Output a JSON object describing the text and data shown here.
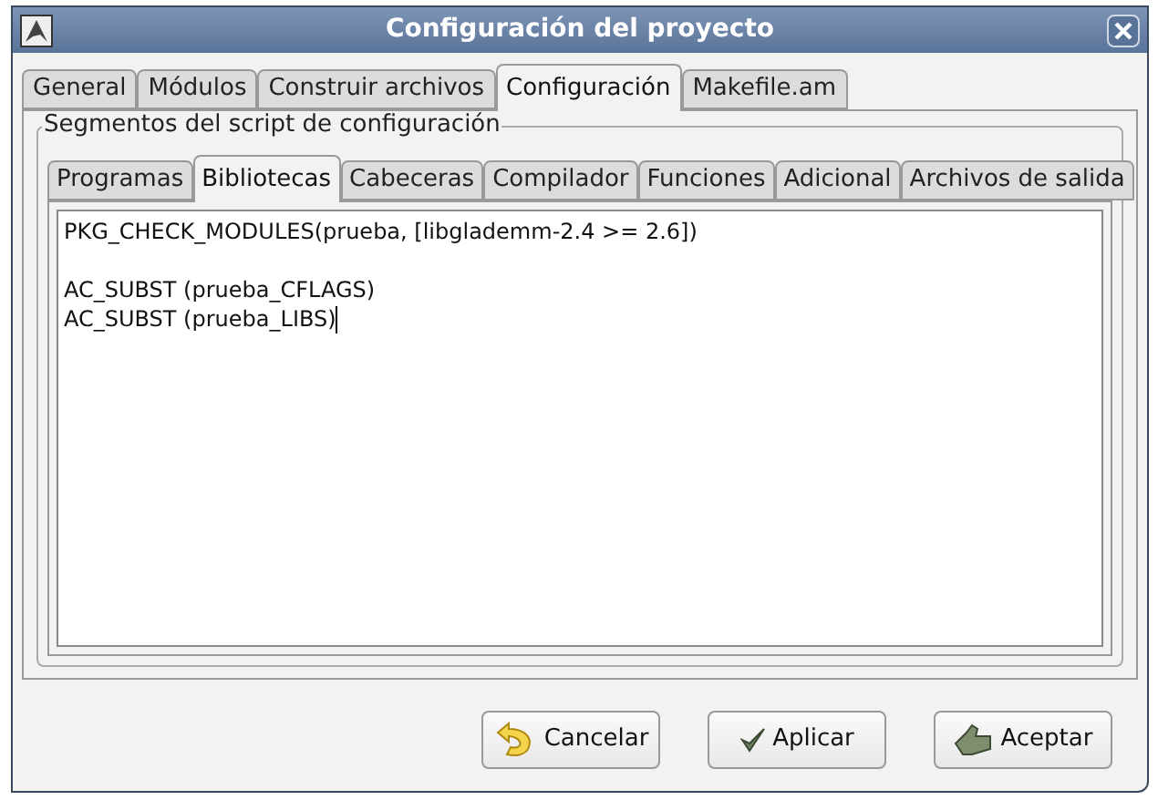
{
  "window": {
    "title": "Configuración del proyecto"
  },
  "tabs": [
    {
      "label": "General",
      "selected": false
    },
    {
      "label": "Módulos",
      "selected": false
    },
    {
      "label": "Construir archivos",
      "selected": false
    },
    {
      "label": "Configuración",
      "selected": true
    },
    {
      "label": "Makefile.am",
      "selected": false
    }
  ],
  "frame": {
    "title": "Segmentos del script de configuración"
  },
  "subtabs": [
    {
      "label": "Programas",
      "selected": false
    },
    {
      "label": "Bibliotecas",
      "selected": true
    },
    {
      "label": "Cabeceras",
      "selected": false
    },
    {
      "label": "Compilador",
      "selected": false
    },
    {
      "label": "Funciones",
      "selected": false
    },
    {
      "label": "Adicional",
      "selected": false
    },
    {
      "label": "Archivos de salida",
      "selected": false
    }
  ],
  "editor": {
    "paragraphs": [
      [
        "PKG_CHECK_MODULES(prueba, [libglademm-2.4 >= 2.6])"
      ],
      [
        "AC_SUBST (prueba_CFLAGS)",
        "AC_SUBST (prueba_LIBS)"
      ]
    ]
  },
  "buttons": [
    {
      "kind": "cancel",
      "label": "Cancelar"
    },
    {
      "kind": "apply",
      "label": "Aplicar"
    },
    {
      "kind": "ok",
      "label": "Aceptar"
    }
  ]
}
